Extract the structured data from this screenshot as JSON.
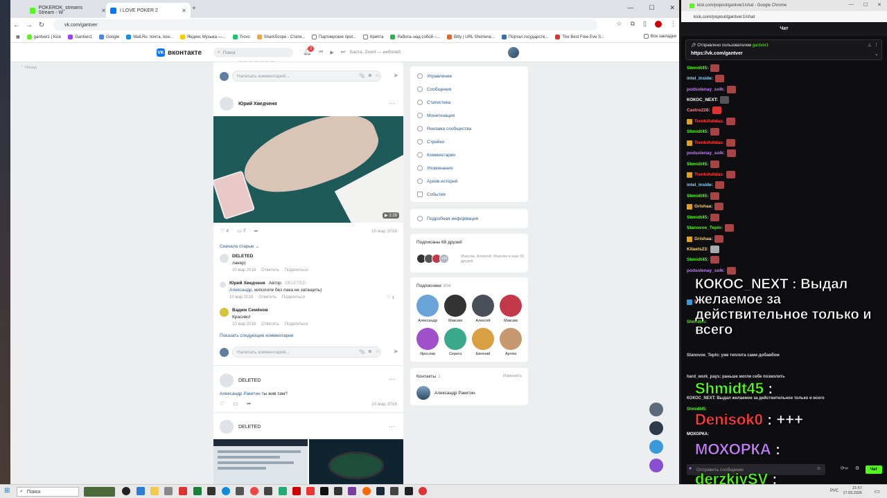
{
  "browser": {
    "tabs": [
      {
        "label": "POKEROK_streams Stream - W",
        "active": false,
        "color": "#53fc18"
      },
      {
        "label": "I LOVE POKER 2",
        "active": true,
        "color": "#0077ff"
      }
    ],
    "url": "vk.com/gantver",
    "bookmarks": [
      "gantver1 | Kick",
      "Gantver1",
      "Google",
      "Mail.Ru: почта, пои...",
      "Яндекс Музыка —...",
      "Trovo",
      "SharkScope - Стати...",
      "Партнерские прог...",
      "Крипта",
      "Работа–над собой –...",
      "Bitly | URL Shortene...",
      "Портал государств...",
      "The Best Free Eve S..."
    ],
    "bookmarks_other": "Все закладки"
  },
  "vk": {
    "logo": "вконтакте",
    "search_placeholder": "Поиск",
    "notif_count": "7",
    "track": "Баста, Zivert — неболей",
    "left_nav": "Назад",
    "comment_placeholder": "Написать комментарий...",
    "post1": {
      "author": "Юрий Хведченя",
      "duration": "2:28",
      "likes": "4",
      "comments": "7",
      "date": "10 мар 2018"
    },
    "sort_label": "Сначала старые",
    "comments": [
      {
        "name": "DELETED",
        "text": "лакер)",
        "date": "10 мар 2018",
        "reply": "Ответить",
        "share": "Поделиться"
      },
      {
        "name": "Юрий Хведченя",
        "author_tag": "Автор",
        "deleted": "DELETED",
        "mention": "Александр,",
        "text": " киполопе без лака не затащить)",
        "date": "10 мар 2018",
        "reply": "Ответить",
        "share": "Поделиться",
        "likes": "1"
      },
      {
        "name": "Вадим Семёнов",
        "text": "Красиво!",
        "date": "10 мар 2018",
        "reply": "Ответить",
        "share": "Поделиться"
      }
    ],
    "show_more": "Показать следующие комментарии",
    "post2": {
      "author": "DELETED",
      "mention": "Александр Ракитин",
      "text": " ты жив там?",
      "date": "10 мар 2018"
    },
    "post3": {
      "author": "DELETED"
    },
    "menu": [
      "Управление",
      "Сообщения",
      "Статистика",
      "Монетизация",
      "Реклама сообщества",
      "Стрийки",
      "Комментарии",
      "Упоминания",
      "Архив историй",
      "События"
    ],
    "info": "Подробная информация",
    "friends_title": "Подписаны 68 друзей",
    "friends_text": "Максим, Алексей, Максим и ещё 65 друзей",
    "friends_more": "+65",
    "subs_title": "Подписчики",
    "subs_count": "894",
    "subs": [
      {
        "name": "Александр",
        "color": "#6aa3d8"
      },
      {
        "name": "Максим",
        "color": "#333333"
      },
      {
        "name": "Алексей",
        "color": "#4a4f5a"
      },
      {
        "name": "Максим",
        "color": "#c23a4a"
      },
      {
        "name": "Ярослав",
        "color": "#a050c8"
      },
      {
        "name": "Серега",
        "color": "#3aa88a"
      },
      {
        "name": "Евгений",
        "color": "#d8a040"
      },
      {
        "name": "Артём",
        "color": "#c89870"
      }
    ],
    "contacts_title": "Контакты",
    "contacts_count": "1",
    "contacts_edit": "Изменить",
    "contact_name": "Александр Ракитин"
  },
  "chat_window": {
    "title": "kick.com/popout/gantver1/chat - Google Chrome",
    "url": "kick.com/popout/gantver1/chat",
    "header": "Чат",
    "pinned_by": "Отправлено пользователем",
    "pinned_user": "gantver1",
    "pinned_link": "https://vk.com/gantver",
    "messages": [
      {
        "user": "Shmidt45:",
        "color": "#53fc18",
        "badge": false
      },
      {
        "user": "intel_inside:",
        "color": "#8fd6ff",
        "badge": false
      },
      {
        "user": "podsolenay_solk:",
        "color": "#c77dff",
        "badge": false
      },
      {
        "user": "КОКОС_NEXT:",
        "color": "#ffffff",
        "badge": false
      },
      {
        "user": "Castro228:",
        "color": "#ff8a8a",
        "badge": false
      },
      {
        "user": "TrenkiAdidas:",
        "color": "#ff4040",
        "badge": true
      },
      {
        "user": "Shmidt45:",
        "color": "#53fc18",
        "badge": false
      },
      {
        "user": "TrenkiAdidas:",
        "color": "#ff4040",
        "badge": true
      },
      {
        "user": "podsolenay_solk:",
        "color": "#c77dff",
        "badge": false
      },
      {
        "user": "Shmidt45:",
        "color": "#53fc18",
        "badge": false
      },
      {
        "user": "TrenkiAdidas:",
        "color": "#ff4040",
        "badge": true
      },
      {
        "user": "intel_inside:",
        "color": "#8fd6ff",
        "badge": false
      },
      {
        "user": "Shmidt45:",
        "color": "#53fc18",
        "badge": false
      },
      {
        "user": "Grishaa:",
        "color": "#ffd479",
        "badge": true
      },
      {
        "user": "Shmidt45:",
        "color": "#53fc18",
        "badge": false
      },
      {
        "user": "Stanovoe_Teplo:",
        "color": "#53fc18",
        "badge": false
      },
      {
        "user": "Grishaa:",
        "color": "#ffd479",
        "badge": true
      },
      {
        "user": "Kitaets23:",
        "color": "#ffd479",
        "badge": false
      },
      {
        "user": "Shmidt45:",
        "color": "#53fc18",
        "badge": false
      },
      {
        "user": "podsolenay_solk:",
        "color": "#c77dff",
        "badge": false
      }
    ],
    "big1_user": "КОКОС_NEXT",
    "big1_text": " : Выдал желаемое за действительное только и всего",
    "small_lines": [
      "Ernem:",
      "Shmidt45:",
      "Stanovoe_Teplo: уже теплота сами добавбом",
      "hard_work_pays: раньше могли себе позволить",
      "КОКОС_NEXT: Выдал желаемое за действительное только и всего",
      "Shmidt45:",
      "МОХОРКА:"
    ],
    "big2_user": "Shmidt45",
    "big2_text": " :",
    "big3_user": "Denisok0",
    "big3_text": " : +++",
    "big4_user": "МОХОРКА",
    "big4_text": " :",
    "big5_user": "derzkiySV",
    "big5_text": " :",
    "input_placeholder": "Отправить сообщение",
    "send_label": "Чат"
  },
  "taskbar": {
    "search": "Поиск",
    "lang": "РУС",
    "time": "21:57",
    "date": "17.03.2026"
  }
}
